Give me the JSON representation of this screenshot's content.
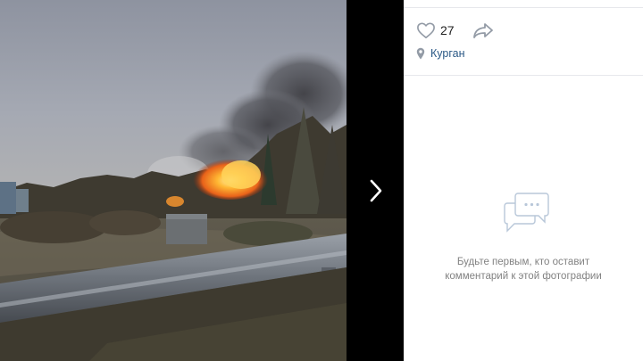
{
  "photo": {
    "description_icon": "photo"
  },
  "viewer": {
    "next_icon": "chevron-right-icon"
  },
  "post": {
    "like_icon": "heart-icon",
    "likes_count": "27",
    "share_icon": "share-arrow-icon",
    "location_icon": "map-pin-icon",
    "location": "Курган"
  },
  "comments": {
    "empty_icon": "comments-empty-icon",
    "empty_line1": "Будьте первым, кто оставит",
    "empty_line2": "комментарий к этой фотографии"
  },
  "colors": {
    "link": "#2a5885",
    "muted": "#828282",
    "icon": "#939ba6",
    "accent": "#5181b8"
  }
}
